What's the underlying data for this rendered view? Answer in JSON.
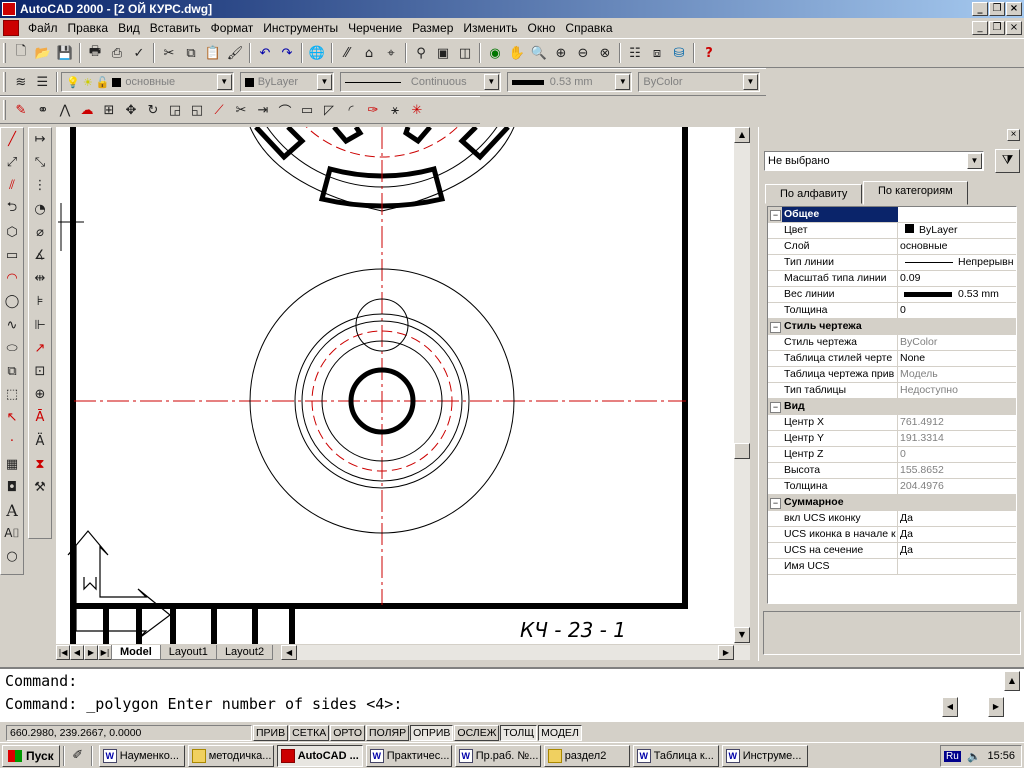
{
  "window": {
    "title": "AutoCAD 2000 - [2 ОЙ КУРС.dwg]"
  },
  "menu": [
    "Файл",
    "Правка",
    "Вид",
    "Вставить",
    "Формат",
    "Инструменты",
    "Черчение",
    "Размер",
    "Изменить",
    "Окно",
    "Справка"
  ],
  "layer_toolbar": {
    "layer": "основные",
    "color": "ByLayer",
    "linetype": "Continuous",
    "lineweight": "0.53 mm",
    "plotstyle": "ByColor"
  },
  "drawing": {
    "stamp": "КЧ - 23 - 1"
  },
  "layout_tabs": [
    "Model",
    "Layout1",
    "Layout2"
  ],
  "properties": {
    "selection": "Не выбрано",
    "tabs": [
      "По алфавиту",
      "По категориям"
    ],
    "rows": [
      {
        "name": "Общее",
        "category": true
      },
      {
        "name": "Цвет",
        "value": "ByLayer",
        "swatch": "#000000"
      },
      {
        "name": "Слой",
        "value": "основные"
      },
      {
        "name": "Тип линии",
        "value": "Непрерывн"
      },
      {
        "name": "Масштаб типа линии",
        "value": "0.09"
      },
      {
        "name": "Вес линии",
        "value": "0.53 mm"
      },
      {
        "name": "Толщина",
        "value": "0"
      },
      {
        "name": "Стиль чертежа",
        "category": true
      },
      {
        "name": "Стиль чертежа",
        "value": "ByColor",
        "dim": true
      },
      {
        "name": "Таблица стилей черте",
        "value": "None"
      },
      {
        "name": "Таблица чертежа прив",
        "value": "Модель",
        "dim": true
      },
      {
        "name": "Тип таблицы",
        "value": "Недоступно",
        "dim": true
      },
      {
        "name": "Вид",
        "category": true
      },
      {
        "name": "Центр X",
        "value": "761.4912",
        "dim": true
      },
      {
        "name": "Центр Y",
        "value": "191.3314",
        "dim": true
      },
      {
        "name": "Центр Z",
        "value": "0",
        "dim": true
      },
      {
        "name": "Высота",
        "value": "155.8652",
        "dim": true
      },
      {
        "name": "Толщина",
        "value": "204.4976",
        "dim": true
      },
      {
        "name": "Суммарное",
        "category": true
      },
      {
        "name": "вкл UCS иконку",
        "value": "Да"
      },
      {
        "name": "UCS иконка в начале к",
        "value": "Да"
      },
      {
        "name": "UCS на сечение",
        "value": "Да"
      },
      {
        "name": "Имя UCS",
        "value": ""
      }
    ]
  },
  "command": {
    "line1": "Command:",
    "line2": "Command: _polygon Enter number of sides <4>:"
  },
  "status": {
    "coords": "660.2980, 239.2667, 0.0000",
    "toggles": [
      {
        "label": "ПРИВ",
        "on": false
      },
      {
        "label": "СЕТКА",
        "on": false
      },
      {
        "label": "ОРТО",
        "on": false
      },
      {
        "label": "ПОЛЯР",
        "on": false
      },
      {
        "label": "ОПРИВ",
        "on": true
      },
      {
        "label": "ОСЛЕЖ",
        "on": false
      },
      {
        "label": "ТОЛЩ",
        "on": true
      },
      {
        "label": "МОДЕЛ",
        "on": true
      }
    ]
  },
  "taskbar": {
    "start": "Пуск",
    "items": [
      {
        "label": "Науменко...",
        "icon": "word",
        "active": false
      },
      {
        "label": "методичка...",
        "icon": "folder",
        "active": false
      },
      {
        "label": "AutoCAD ...",
        "icon": "autocad",
        "active": true
      },
      {
        "label": "Практичес...",
        "icon": "word",
        "active": false
      },
      {
        "label": "Пр.раб. №...",
        "icon": "word",
        "active": false
      },
      {
        "label": "раздел2",
        "icon": "folder",
        "active": false
      },
      {
        "label": "Таблица к...",
        "icon": "word",
        "active": false
      },
      {
        "label": "Инструме...",
        "icon": "word",
        "active": false
      }
    ],
    "lang": "Ru",
    "clock": "15:56"
  }
}
